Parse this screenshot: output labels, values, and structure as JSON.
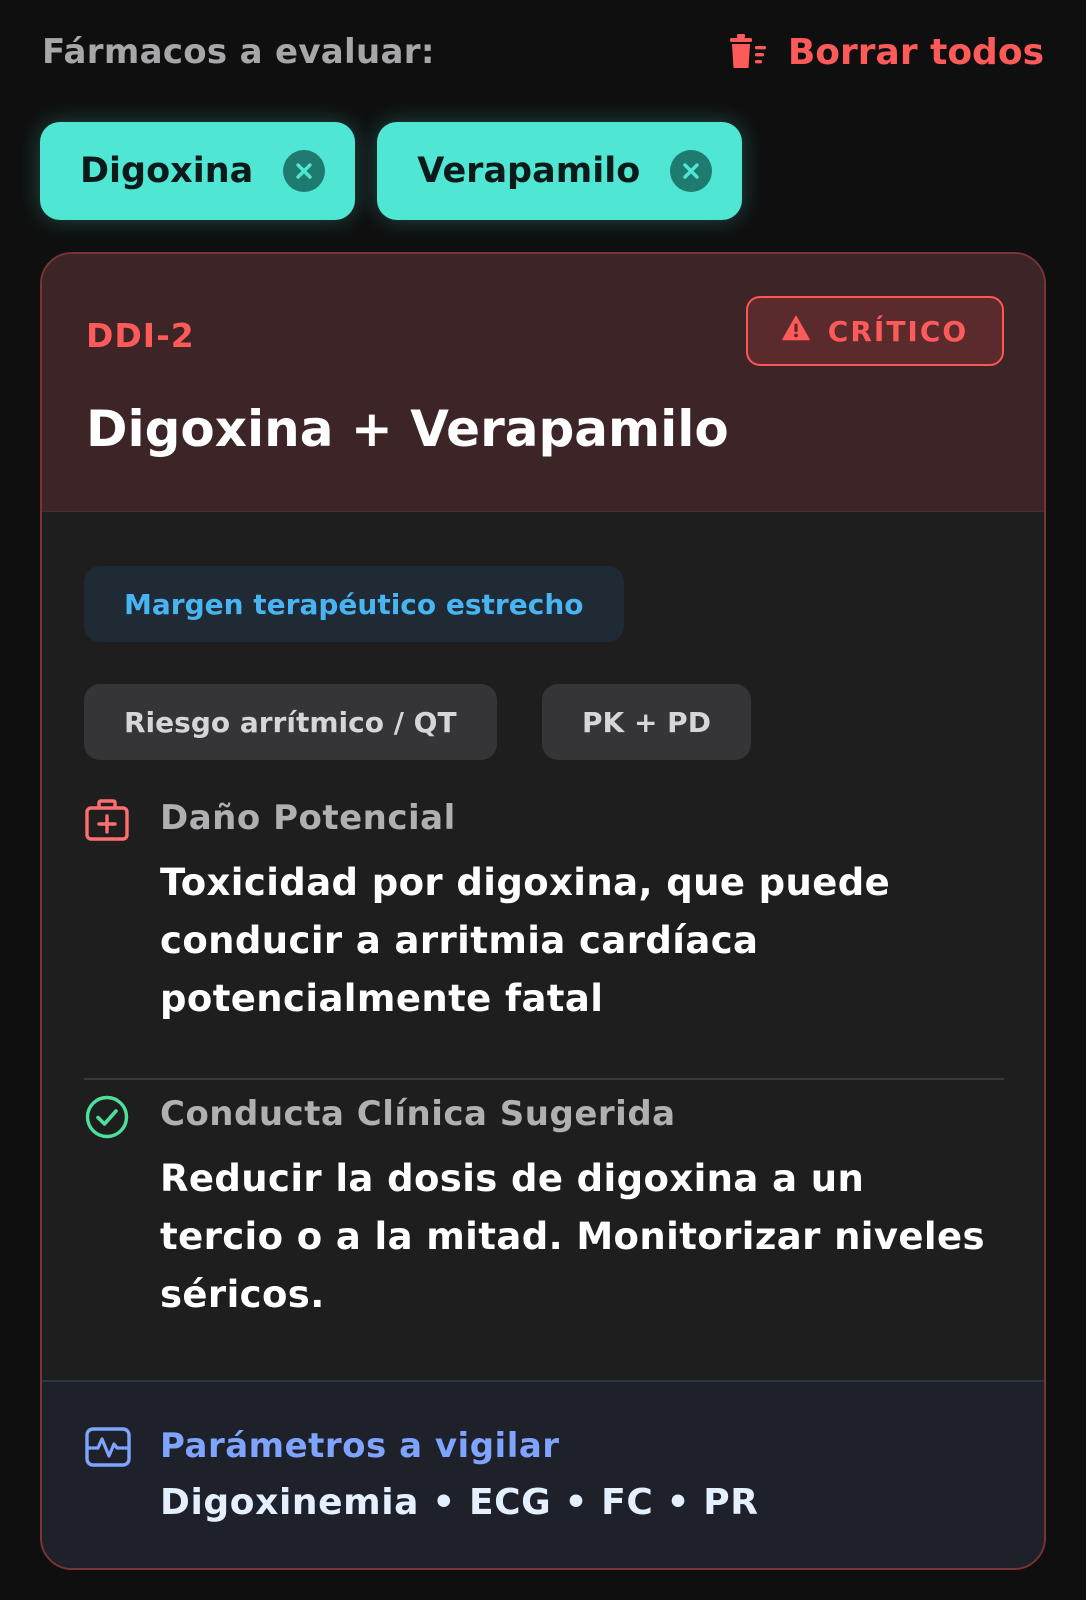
{
  "header": {
    "title": "Fármacos a evaluar:",
    "clear_all_label": "Borrar todos"
  },
  "selected_drugs": [
    {
      "name": "Digoxina"
    },
    {
      "name": "Verapamilo"
    }
  ],
  "interaction": {
    "id": "DDI-2",
    "severity": "CRÍTICO",
    "title": "Digoxina + Verapamilo",
    "tags": {
      "primary": "Margen terapéutico estrecho",
      "secondary": [
        "Riesgo arrítmico / QT",
        "PK + PD"
      ]
    },
    "harm": {
      "label": "Daño Potencial",
      "text": "Toxicidad por digoxina, que puede conducir a arritmia cardíaca potencialmente fatal"
    },
    "action": {
      "label": "Conducta Clínica Sugerida",
      "text": "Reducir la dosis de digoxina a un tercio o a la mitad. Monitorizar niveles séricos."
    },
    "monitor": {
      "label": "Parámetros a vigilar",
      "text": "Digoxinemia • ECG • FC • PR"
    }
  },
  "icons": {
    "clear": "trash-icon",
    "remove": "close-circle-icon",
    "severity": "warning-triangle-icon",
    "harm": "medical-kit-icon",
    "action": "check-circle-icon",
    "monitor": "pulse-monitor-icon"
  },
  "colors": {
    "background": "#0f0f10",
    "chip": "#4fe6d3",
    "critical": "#ff5a5a",
    "card_header": "#3d2426",
    "tag_blue": "#49b4f2",
    "success": "#4ddf9c",
    "monitor": "#7ea4ff"
  }
}
